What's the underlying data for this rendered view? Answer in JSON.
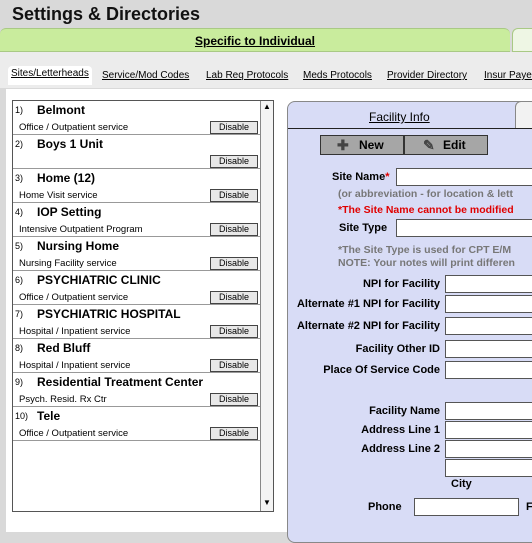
{
  "window": {
    "title": "Settings & Directories"
  },
  "banner": {
    "label": "Specific to Individual"
  },
  "tabs": [
    "Sites/Letterheads",
    "Service/Mod Codes",
    "Lab Req Protocols",
    "Meds Protocols",
    "Provider Directory",
    "Insur Payers"
  ],
  "sites": [
    {
      "num": "1)",
      "name": "Belmont",
      "type": "Office / Outpatient service",
      "action": "Disable"
    },
    {
      "num": "2)",
      "name": "Boys 1 Unit",
      "type": "",
      "action": "Disable"
    },
    {
      "num": "3)",
      "name": "Home (12)",
      "type": "Home Visit service",
      "action": "Disable"
    },
    {
      "num": "4)",
      "name": "IOP Setting",
      "type": "Intensive Outpatient Program",
      "action": "Disable"
    },
    {
      "num": "5)",
      "name": "Nursing Home",
      "type": "Nursing Facility service",
      "action": "Disable"
    },
    {
      "num": "6)",
      "name": "PSYCHIATRIC  CLINIC",
      "type": "Office / Outpatient service",
      "action": "Disable"
    },
    {
      "num": "7)",
      "name": "PSYCHIATRIC HOSPITAL",
      "type": "Hospital / Inpatient service",
      "action": "Disable"
    },
    {
      "num": "8)",
      "name": "Red Bluff",
      "type": "Hospital / Inpatient service",
      "action": "Disable"
    },
    {
      "num": "9)",
      "name": "Residential Treatment Center",
      "type": "Psych. Resid. Rx Ctr",
      "action": "Disable"
    },
    {
      "num": "10)",
      "name": "Tele",
      "type": "Office / Outpatient service",
      "action": "Disable"
    }
  ],
  "facility": {
    "title": "Facility Info",
    "new_label": "New",
    "edit_label": "Edit",
    "site_name_label": "Site Name",
    "required_mark": "*",
    "site_name_note": "(or abbreviation -  for location & lett",
    "site_name_warning": "*The Site Name cannot be modified",
    "site_type_label": "Site Type",
    "site_type_note1": "*The Site Type is used for CPT E/M",
    "site_type_note2": "NOTE: Your notes will print differen",
    "npi_label": "NPI for Facility",
    "alt1_label": "Alternate #1 NPI for Facility",
    "alt2_label": "Alternate #2 NPI for Facility",
    "other_id_label": "Facility Other ID",
    "pos_label": "Place Of Service Code",
    "name_label": "Facility Name",
    "addr1_label": "Address Line 1",
    "addr2_label": "Address Line 2",
    "city_label": "City",
    "phone_label": "Phone",
    "trailing_label": "F"
  }
}
